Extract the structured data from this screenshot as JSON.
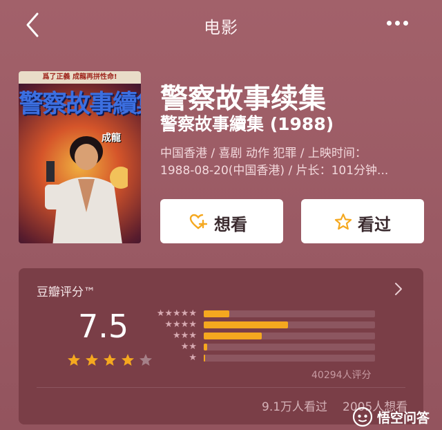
{
  "header": {
    "title": "电影"
  },
  "movie": {
    "poster": {
      "tagline": "爲了正義 成龍再拼性命!",
      "title": "警察故事續集",
      "star": "成龍"
    },
    "title": "警察故事续集",
    "subtitle": "警察故事續集 (1988)",
    "info_line1": "中国香港 / 喜剧 动作 犯罪 / 上映时间：",
    "info_line2": "1988-08-20(中国香港) / 片长：101分钟..."
  },
  "actions": {
    "want_label": "想看",
    "seen_label": "看过"
  },
  "rating": {
    "heading": "豆瓣评分™",
    "score": "7.5",
    "stars_filled": 4,
    "stars_total": 5,
    "distribution": [
      {
        "stars": 5,
        "fraction": 0.15
      },
      {
        "stars": 4,
        "fraction": 0.49
      },
      {
        "stars": 3,
        "fraction": 0.34
      },
      {
        "stars": 2,
        "fraction": 0.02
      },
      {
        "stars": 1,
        "fraction": 0.005
      }
    ],
    "count_text": "40294人评分",
    "watched": "9.1万人看过",
    "want": "2005人想看"
  },
  "colors": {
    "background": "#9d5c66",
    "card": "#7a3e47",
    "accent": "#f5a81f"
  },
  "icons": {
    "back": "back-chevron-icon",
    "more": "more-dots-icon",
    "want": "heart-plus-icon",
    "seen": "star-outline-icon",
    "chevron": "chevron-right-icon"
  },
  "watermark": {
    "text": "悟空问答"
  }
}
